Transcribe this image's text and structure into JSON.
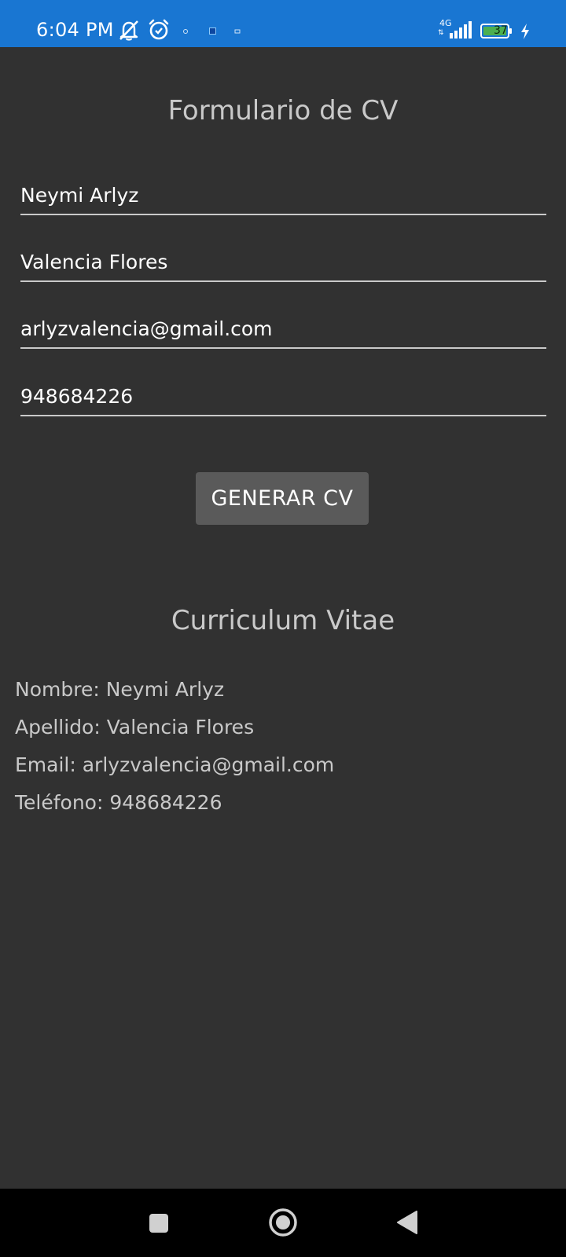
{
  "status_bar": {
    "time": "6:04 PM",
    "network": "4G",
    "network_arrows": "⇅",
    "battery_level": "37",
    "icons": [
      "mute-icon",
      "alarm-icon",
      "notification-icon",
      "app-notification-icon",
      "notification-icon",
      "signal-icon",
      "battery-icon",
      "charging-icon"
    ]
  },
  "form": {
    "title": "Formulario de CV",
    "fields": [
      {
        "value": "Neymi Arlyz"
      },
      {
        "value": "Valencia Flores"
      },
      {
        "value": "arlyzvalencia@gmail.com"
      },
      {
        "value": "948684226"
      }
    ],
    "generate_label": "GENERAR CV"
  },
  "cv": {
    "title": "Curriculum Vitae",
    "name_line": "Nombre: Neymi Arlyz",
    "surname_line": "Apellido: Valencia Flores",
    "email_line": "Email: arlyzvalencia@gmail.com",
    "phone_line": "Teléfono: 948684226"
  },
  "nav_bar": {
    "icons": [
      "recents-icon",
      "home-icon",
      "back-icon"
    ]
  },
  "colors": {
    "status_bar": "#1976d2",
    "background": "#313131",
    "button": "#5a5a5a",
    "text_muted": "#c9c9c9",
    "text": "#ffffff",
    "battery": "#4caf50"
  }
}
